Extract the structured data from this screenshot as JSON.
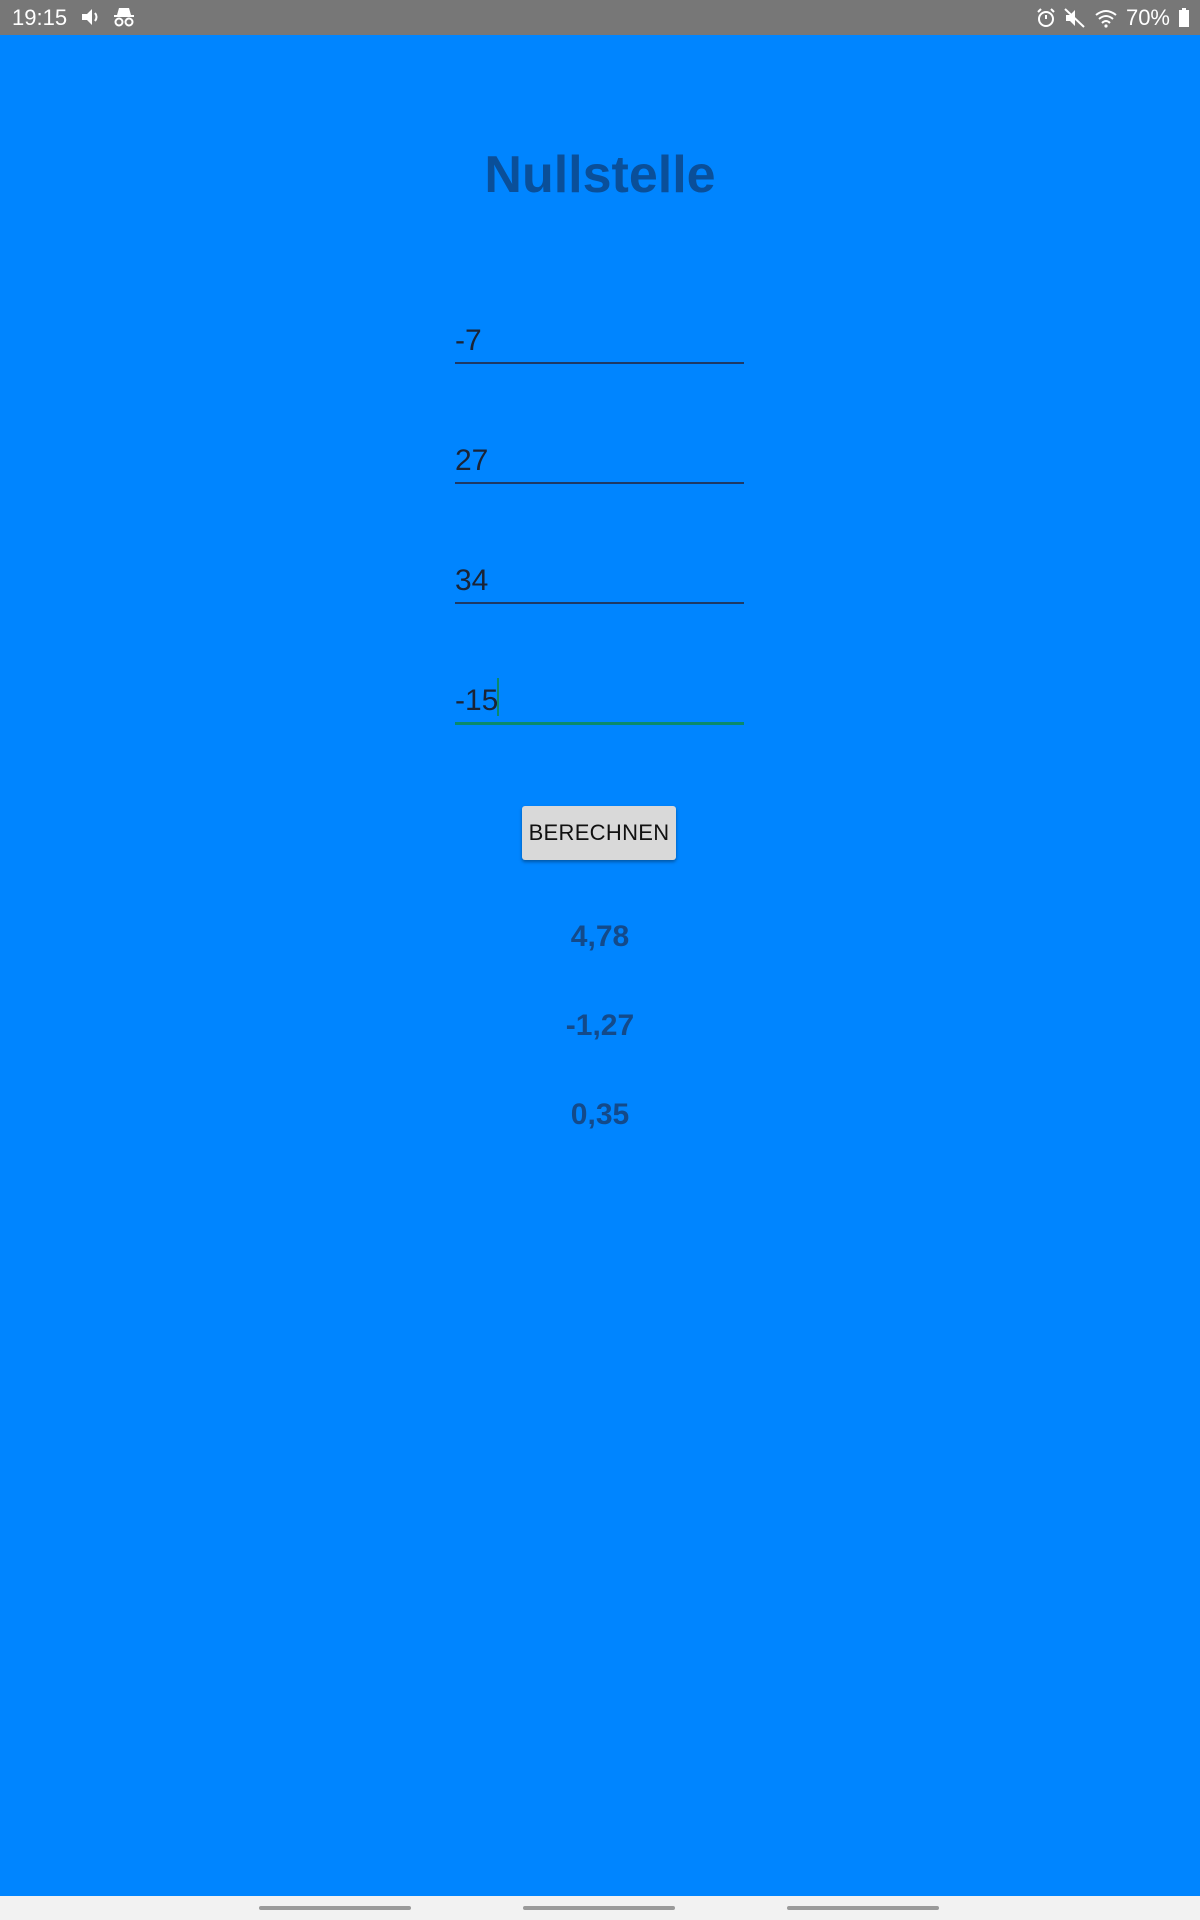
{
  "status_bar": {
    "time": "19:15",
    "battery": "70%",
    "icons_left": [
      "speaker-icon",
      "incognito-icon"
    ],
    "icons_right": [
      "alarm-icon",
      "mute-icon",
      "wifi-icon",
      "battery-icon"
    ]
  },
  "app": {
    "title": "Nullstelle",
    "background_color": "#0085ff"
  },
  "inputs": {
    "field1": "-7",
    "field2": "27",
    "field3": "34",
    "field4": "-15"
  },
  "button": {
    "label": "BERECHNEN"
  },
  "results": {
    "r1": "4,78",
    "r2": "-1,27",
    "r3": "0,35"
  }
}
